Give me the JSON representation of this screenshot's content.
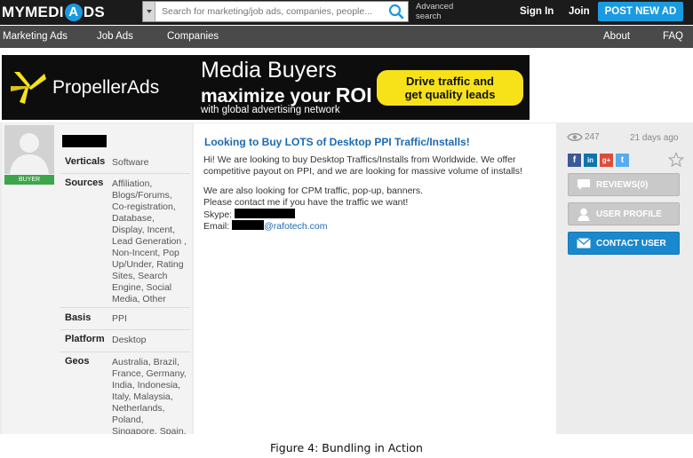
{
  "topbar": {
    "logo_a": "MYMEDI",
    "logo_b": "A",
    "logo_c": "DS",
    "search_placeholder": "Search for marketing/job ads, companies, people...",
    "advanced_search": "Advanced search",
    "sign_in": "Sign In",
    "join": "Join",
    "post_new_ad": "POST NEW AD"
  },
  "nav": {
    "marketing_ads": "Marketing Ads",
    "job_ads": "Job Ads",
    "companies": "Companies",
    "about": "About",
    "faq": "FAQ"
  },
  "banner": {
    "brand": "PropellerAds",
    "headline": "Media Buyers",
    "tagline_a": "maximize your ",
    "tagline_b": "ROI",
    "subline": "with global advertising network",
    "cta_line1": "Drive traffic and",
    "cta_line2": "get quality leads",
    "colors": {
      "background": "#0d0d0d",
      "cta": "#f7e21a"
    }
  },
  "profile": {
    "badge": "BUYER",
    "attributes": [
      {
        "label": "Verticals",
        "value": "Software"
      },
      {
        "label": "Sources",
        "value": "Affiliation, Blogs/Forums, Co-registration, Database, Display, Incent, Lead Generation , Non-Incent, Pop Up/Under, Rating Sites, Search Engine, Social Media, Other"
      },
      {
        "label": "Basis",
        "value": "PPI"
      },
      {
        "label": "Platform",
        "value": "Desktop"
      },
      {
        "label": "Geos",
        "value": "Australia, Brazil, France, Germany, India, Indonesia, Italy, Malaysia, Netherlands, Poland, Singapore, Spain,"
      }
    ]
  },
  "ad": {
    "title": "Looking to Buy LOTS of Desktop PPI Traffic/Installs!",
    "para1": "Hi! We are looking to buy Desktop Traffics/Installs from Worldwide. We offer competitive payout on PPI, and we are looking for massive volume of installs!",
    "para2_line1": "We are also looking for CPM traffic, pop-up, banners.",
    "para2_line2": "Please contact me if you have the traffic we want!",
    "skype_label": "Skype:",
    "email_label": "Email:",
    "email_domain": "@rafotech.com"
  },
  "sidebar": {
    "views": "247",
    "posted": "21 days ago",
    "share_icons": [
      "facebook-icon",
      "linkedin-icon",
      "google-plus-icon",
      "twitter-icon"
    ],
    "share_glyphs": {
      "facebook": "f",
      "linkedin": "in",
      "googleplus": "g+",
      "twitter": "t"
    },
    "reviews": "REVIEWS(0)",
    "user_profile": "USER PROFILE",
    "contact_user": "CONTACT USER",
    "colors": {
      "accent": "#1a88cc",
      "facebook": "#3b5998",
      "linkedin": "#0e76a8",
      "googleplus": "#dd4b39",
      "twitter": "#55acee"
    }
  },
  "caption": "Figure 4: Bundling in Action"
}
